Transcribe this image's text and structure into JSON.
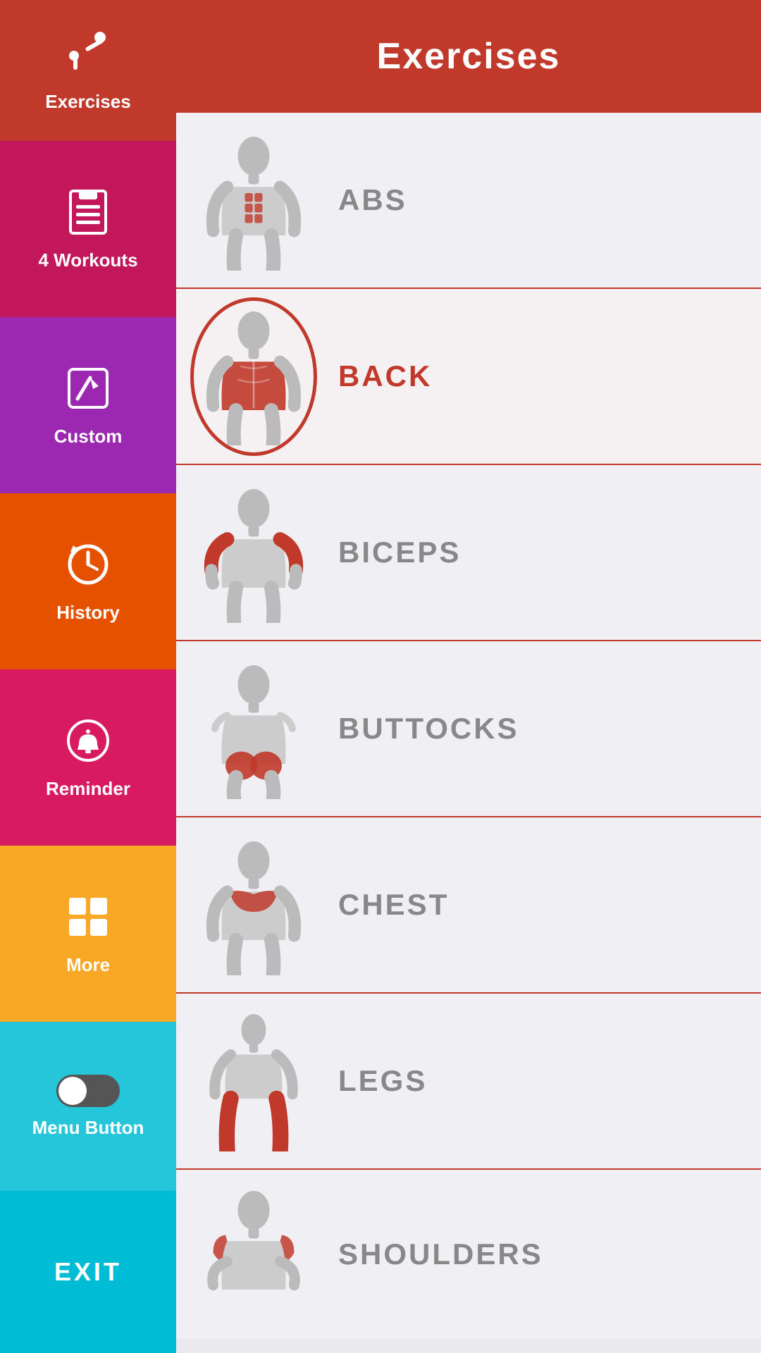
{
  "header": {
    "title": "Exercises"
  },
  "sidebar": {
    "items": [
      {
        "id": "exercises",
        "label": "Exercises",
        "icon": "🏋",
        "bg": "#c0392b"
      },
      {
        "id": "workouts",
        "label": "4 Workouts",
        "icon": "📋",
        "bg": "#c2185b"
      },
      {
        "id": "custom",
        "label": "Custom",
        "icon": "✏️",
        "bg": "#9c27b0"
      },
      {
        "id": "history",
        "label": "History",
        "icon": "🕐",
        "bg": "#e65100"
      },
      {
        "id": "reminder",
        "label": "Reminder",
        "icon": "🔔",
        "bg": "#d81b60"
      },
      {
        "id": "more",
        "label": "More",
        "icon": "⊞",
        "bg": "#f9a825"
      },
      {
        "id": "menubutton",
        "label": "Menu Button",
        "icon": "toggle",
        "bg": "#26c6da"
      },
      {
        "id": "exit",
        "label": "EXIT",
        "icon": "",
        "bg": "#00bcd4"
      }
    ]
  },
  "exercises": [
    {
      "name": "ABS",
      "selected": false
    },
    {
      "name": "BACK",
      "selected": true
    },
    {
      "name": "BICEPS",
      "selected": false
    },
    {
      "name": "BUTTOCKS",
      "selected": false
    },
    {
      "name": "CHEST",
      "selected": false
    },
    {
      "name": "LEGS",
      "selected": false
    },
    {
      "name": "SHOULDERS",
      "selected": false
    }
  ]
}
